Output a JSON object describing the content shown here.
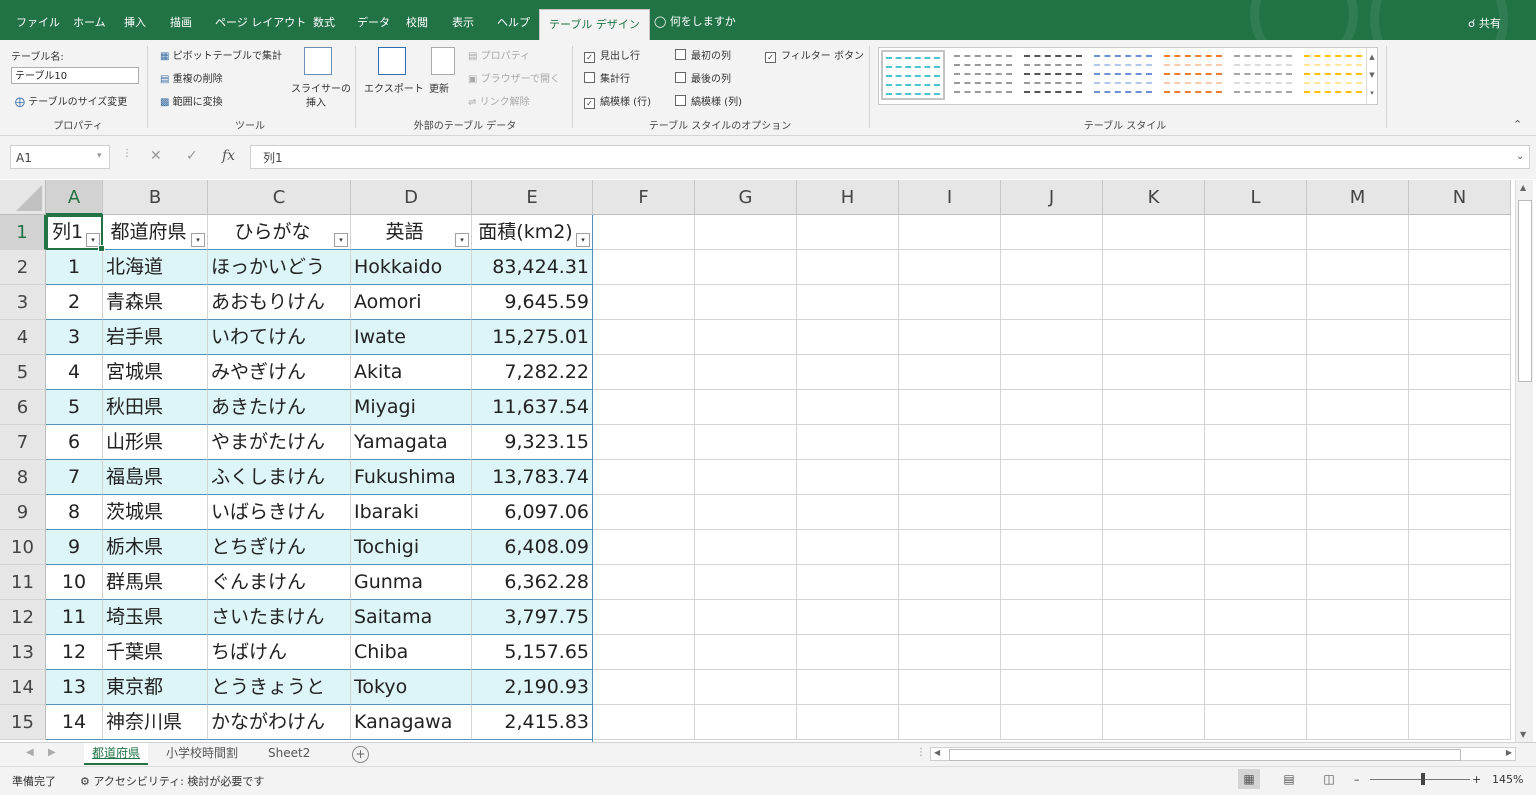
{
  "ribbon_tabs": [
    {
      "label": "ファイル"
    },
    {
      "label": "ホーム"
    },
    {
      "label": "挿入"
    },
    {
      "label": "描画"
    },
    {
      "label": "ページ レイアウト"
    },
    {
      "label": "数式"
    },
    {
      "label": "データ"
    },
    {
      "label": "校閲"
    },
    {
      "label": "表示"
    },
    {
      "label": "ヘルプ"
    },
    {
      "label": "テーブル デザイン"
    }
  ],
  "tell_me": "何をしますか",
  "share_label": "共有",
  "ribbon": {
    "properties": {
      "table_name_label": "テーブル名:",
      "table_name_value": "テーブル10",
      "resize_label": "テーブルのサイズ変更",
      "group_label": "プロパティ"
    },
    "tools": {
      "pivot_label": "ピボットテーブルで集計",
      "remove_dup_label": "重複の削除",
      "convert_range_label": "範囲に変換",
      "slicer_label_1": "スライサーの",
      "slicer_label_2": "挿入",
      "group_label": "ツール"
    },
    "external": {
      "export_label": "エクスポート",
      "refresh_label": "更新",
      "properties_label": "プロパティ",
      "browser_label": "ブラウザーで開く",
      "unlink_label": "リンク解除",
      "group_label": "外部のテーブル データ"
    },
    "style_options": {
      "header_row": "見出し行",
      "total_row": "集計行",
      "banded_rows": "縞模様 (行)",
      "first_column": "最初の列",
      "last_column": "最後の列",
      "banded_columns": "縞模様 (列)",
      "filter_button": "フィルター ボタン",
      "header_row_checked": true,
      "total_row_checked": false,
      "banded_rows_checked": true,
      "first_column_checked": false,
      "last_column_checked": false,
      "banded_columns_checked": false,
      "filter_button_checked": true,
      "group_label": "テーブル スタイルのオプション"
    },
    "table_styles": {
      "group_label": "テーブル スタイル",
      "swatch_colors": [
        "#ffffff",
        "#ffffff",
        "#7f7f7f",
        "#8ea9db",
        "#f4b084",
        "#c9c9c9",
        "#ffd966"
      ]
    }
  },
  "formula_bar": {
    "name_box": "A1",
    "fx_label": "fx",
    "content": "列1"
  },
  "columns": [
    "A",
    "B",
    "C",
    "D",
    "E",
    "F",
    "G",
    "H",
    "I",
    "J",
    "K",
    "L",
    "M",
    "N"
  ],
  "table": {
    "headers": [
      "列1",
      "都道府県",
      "ひらがな",
      "英語",
      "面積(km2)"
    ],
    "rows": [
      {
        "n": "1",
        "pref": "北海道",
        "kana": "ほっかいどう",
        "en": "Hokkaido",
        "area": "83,424.31"
      },
      {
        "n": "2",
        "pref": "青森県",
        "kana": "あおもりけん",
        "en": "Aomori",
        "area": "9,645.59"
      },
      {
        "n": "3",
        "pref": "岩手県",
        "kana": "いわてけん",
        "en": "Iwate",
        "area": "15,275.01"
      },
      {
        "n": "4",
        "pref": "宮城県",
        "kana": "みやぎけん",
        "en": "Akita",
        "area": "7,282.22"
      },
      {
        "n": "5",
        "pref": "秋田県",
        "kana": "あきたけん",
        "en": "Miyagi",
        "area": "11,637.54"
      },
      {
        "n": "6",
        "pref": "山形県",
        "kana": "やまがたけん",
        "en": "Yamagata",
        "area": "9,323.15"
      },
      {
        "n": "7",
        "pref": "福島県",
        "kana": "ふくしまけん",
        "en": "Fukushima",
        "area": "13,783.74"
      },
      {
        "n": "8",
        "pref": "茨城県",
        "kana": "いばらきけん",
        "en": "Ibaraki",
        "area": "6,097.06"
      },
      {
        "n": "9",
        "pref": "栃木県",
        "kana": "とちぎけん",
        "en": "Tochigi",
        "area": "6,408.09"
      },
      {
        "n": "10",
        "pref": "群馬県",
        "kana": "ぐんまけん",
        "en": "Gunma",
        "area": "6,362.28"
      },
      {
        "n": "11",
        "pref": "埼玉県",
        "kana": "さいたまけん",
        "en": "Saitama",
        "area": "3,797.75"
      },
      {
        "n": "12",
        "pref": "千葉県",
        "kana": "ちばけん",
        "en": "Chiba",
        "area": "5,157.65"
      },
      {
        "n": "13",
        "pref": "東京都",
        "kana": "とうきょうと",
        "en": "Tokyo",
        "area": "2,190.93"
      },
      {
        "n": "14",
        "pref": "神奈川県",
        "kana": "かながわけん",
        "en": "Kanagawa",
        "area": "2,415.83"
      }
    ]
  },
  "sheets": [
    {
      "label": "都道府県",
      "active": true
    },
    {
      "label": "小学校時間割",
      "active": false
    },
    {
      "label": "Sheet2",
      "active": false
    }
  ],
  "status": {
    "ready": "準備完了",
    "accessibility": "アクセシビリティ: 検討が必要です",
    "zoom": "145%"
  },
  "colors": {
    "excel_green": "#217346",
    "band_fill": "#ddf5f7",
    "table_border": "#4f94b8"
  }
}
